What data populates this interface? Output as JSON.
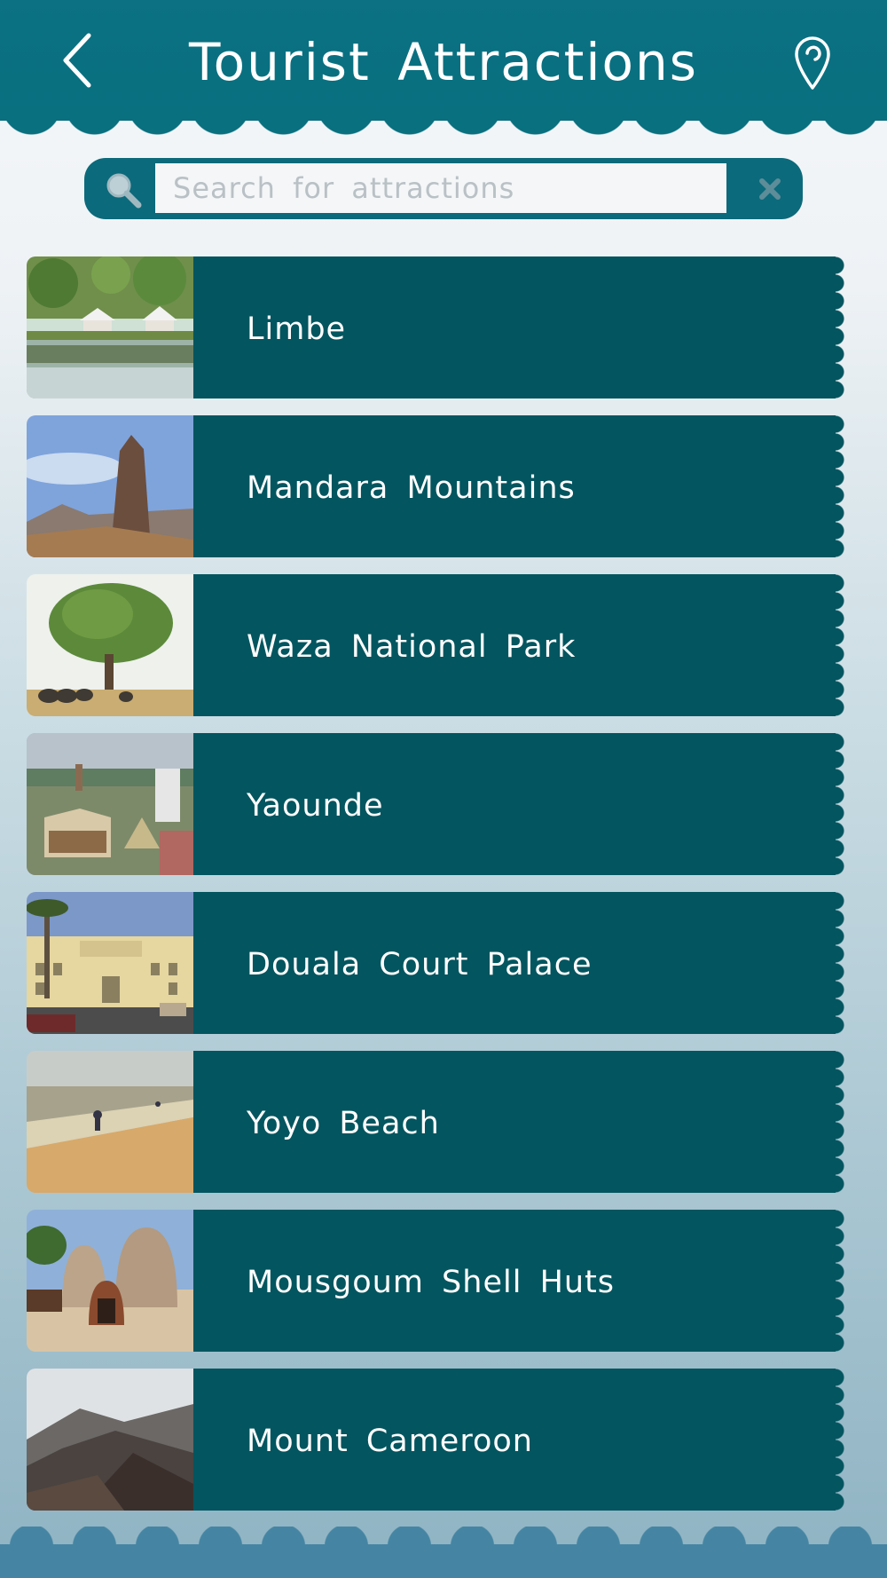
{
  "header": {
    "title": "Tourist Attractions",
    "back_icon": "chevron-left-icon",
    "location_icon": "map-pin-icon",
    "background_color": "#08707f"
  },
  "search": {
    "placeholder": "Search for attractions",
    "value": "",
    "search_icon": "search-icon",
    "clear_icon": "close-icon",
    "accent_color": "#0b6a7b"
  },
  "attractions": [
    {
      "label": "Limbe"
    },
    {
      "label": "Mandara Mountains"
    },
    {
      "label": "Waza National Park"
    },
    {
      "label": "Yaounde"
    },
    {
      "label": "Douala Court Palace"
    },
    {
      "label": "Yoyo Beach"
    },
    {
      "label": "Mousgoum Shell Huts"
    },
    {
      "label": "Mount Cameroon"
    }
  ],
  "theme": {
    "item_color": "#03555f",
    "footer_color": "#4585a3"
  }
}
